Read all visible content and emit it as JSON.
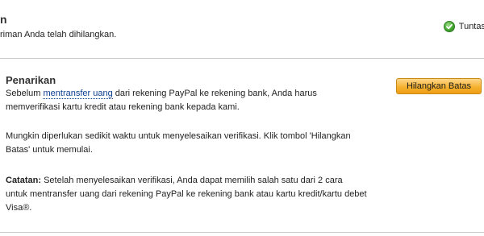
{
  "top_item": {
    "title": "n",
    "description": "riman Anda telah dihilangkan.",
    "status_label": "Tuntas"
  },
  "withdraw": {
    "title": "Penarikan",
    "para1_before": "Sebelum ",
    "para1_link": "mentransfer uang",
    "para1_after_line1": " dari rekening PayPal ke rekening bank, Anda harus",
    "para1_line2": "memverifikasi kartu kredit atau rekening bank kepada kami.",
    "para2_line1": "Mungkin diperlukan sedikit waktu untuk menyelesaikan verifikasi. Klik tombol 'Hilangkan",
    "para2_line2": "Batas' untuk memulai.",
    "note_label": "Catatan:",
    "note_line1_rest": " Setelah menyelesaikan verifikasi, Anda dapat memilih salah satu dari 2 cara",
    "note_line2": "untuk mentransfer uang dari rekening PayPal ke rekening bank atau kartu kredit/kartu debet",
    "note_line3": "Visa®.",
    "button_label": "Hilangkan Batas"
  },
  "colors": {
    "button_orange": "#f5b02c",
    "link_blue": "#0b3d91",
    "check_green": "#46a832",
    "divider": "#cccccc"
  }
}
